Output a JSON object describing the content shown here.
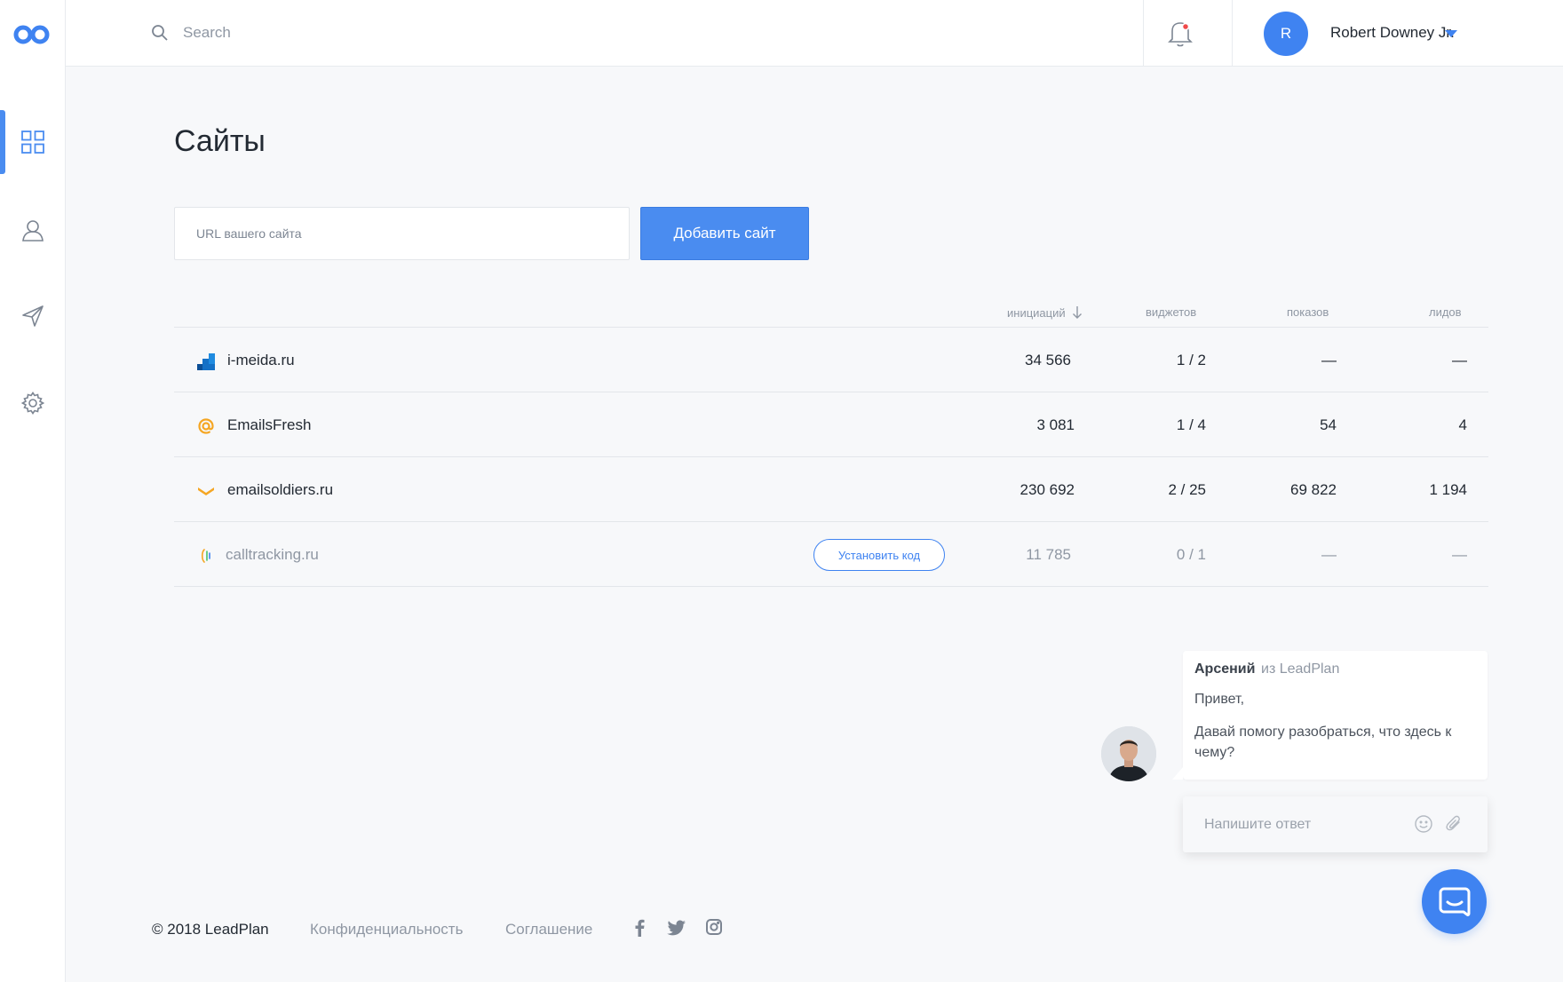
{
  "colors": {
    "accent": "#3f83f1",
    "button": "#4a8cf0",
    "muted": "#8f97a3",
    "text": "#232a33"
  },
  "header": {
    "search_placeholder": "Search",
    "user": {
      "initial": "R",
      "name": "Robert Downey Jr."
    }
  },
  "sidebar": {
    "items": [
      {
        "icon": "dashboard-grid-icon",
        "active": true
      },
      {
        "icon": "user-icon",
        "active": false
      },
      {
        "icon": "send-icon",
        "active": false
      },
      {
        "icon": "settings-gear-icon",
        "active": false
      }
    ]
  },
  "main": {
    "title": "Сайты",
    "url_placeholder": "URL вашего сайта",
    "add_button": "Добавить сайт"
  },
  "table": {
    "columns": [
      {
        "label": "инициаций",
        "sorted": "desc"
      },
      {
        "label": "виджетов"
      },
      {
        "label": "показов"
      },
      {
        "label": "лидов"
      }
    ],
    "rows": [
      {
        "icon": "i-meida-logo-icon",
        "name": "i-meida.ru",
        "initiations": "34 566",
        "widgets": "1 / 2",
        "shows": "—",
        "leads": "—",
        "muted": false
      },
      {
        "icon": "at-sign-logo-icon",
        "name": "EmailsFresh",
        "initiations": "3 081",
        "widgets": "1 / 4",
        "shows": "54",
        "leads": "4",
        "muted": false
      },
      {
        "icon": "chevron-logo-icon",
        "name": "emailsoldiers.ru",
        "initiations": "230 692",
        "widgets": "2 / 25",
        "shows": "69 822",
        "leads": "1 194",
        "muted": false
      },
      {
        "icon": "calltracking-logo-icon",
        "name": "calltracking.ru",
        "initiations": "11 785",
        "widgets": "0 / 1",
        "shows": "—",
        "leads": "—",
        "muted": true,
        "install_button": "Установить код"
      }
    ]
  },
  "chat": {
    "author": "Арсений",
    "from": "из LeadPlan",
    "greeting": "Привет,",
    "message": "Давай помогу разобраться, что здесь к чему?",
    "reply_placeholder": "Напишите ответ"
  },
  "footer": {
    "copyright": "© 2018 LeadPlan",
    "privacy": "Конфиденциальность",
    "agreement": "Соглашение",
    "social": [
      "facebook-icon",
      "twitter-icon",
      "instagram-icon"
    ]
  }
}
